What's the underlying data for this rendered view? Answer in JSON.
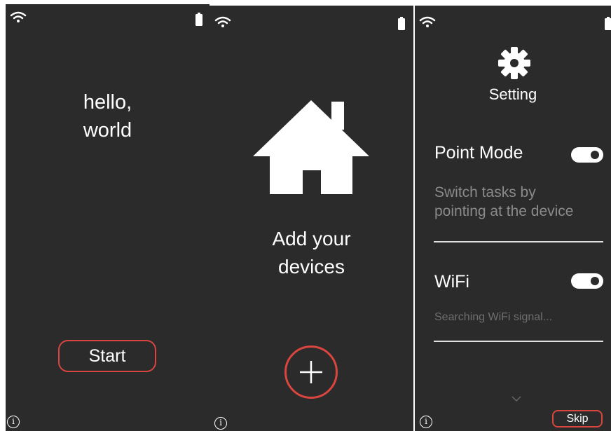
{
  "colors": {
    "background": "#2b2b2b",
    "accent": "#d9453f",
    "text": "#ffffff",
    "muted_text": "#8a8a8a"
  },
  "screens": [
    {
      "greeting": "hello,\nworld",
      "start_label": "Start",
      "icons": [
        "wifi-icon",
        "battery-icon",
        "info-icon"
      ],
      "info_glyph": "i"
    },
    {
      "prompt": "Add your\ndevices",
      "icons": [
        "wifi-icon",
        "battery-icon",
        "house-icon",
        "plus-icon",
        "info-icon"
      ],
      "info_glyph": "i"
    },
    {
      "title": "Setting",
      "point_mode": {
        "label": "Point Mode",
        "enabled": true,
        "description": "Switch tasks by\npointing at the device"
      },
      "wifi": {
        "label": "WiFi",
        "enabled": true,
        "status": "Searching WiFi signal..."
      },
      "skip_label": "Skip",
      "icons": [
        "wifi-icon",
        "battery-icon",
        "gear-icon",
        "chevron-down-icon",
        "info-icon"
      ],
      "info_glyph": "i"
    }
  ]
}
